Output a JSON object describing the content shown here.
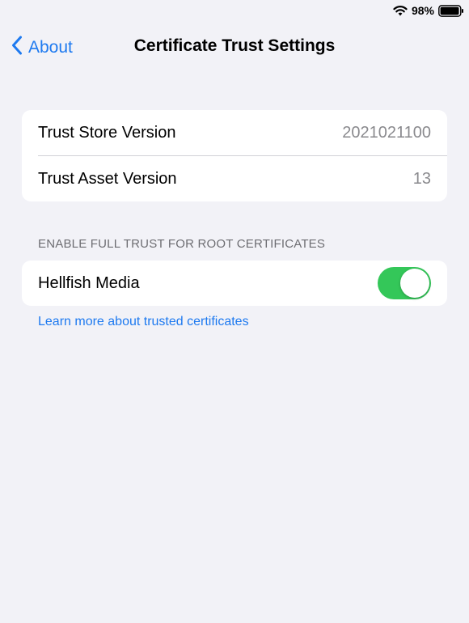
{
  "status_bar": {
    "battery_percent": "98%",
    "wifi_icon": "wifi-icon",
    "battery_icon": "battery-icon",
    "battery_level": 0.98
  },
  "nav": {
    "back_label": "About",
    "back_icon": "chevron-left-icon",
    "title": "Certificate Trust Settings"
  },
  "version_info": {
    "rows": [
      {
        "label": "Trust Store Version",
        "value": "2021021100"
      },
      {
        "label": "Trust Asset Version",
        "value": "13"
      }
    ]
  },
  "trust_section": {
    "header": "ENABLE FULL TRUST FOR ROOT CERTIFICATES",
    "certificates": [
      {
        "label": "Hellfish Media",
        "enabled": true
      }
    ],
    "learn_more_link": "Learn more about trusted certificates"
  },
  "colors": {
    "background": "#F2F2F7",
    "accent": "#1E7AF0",
    "toggle_on": "#34C759",
    "secondary_text": "#8A8A8E"
  }
}
